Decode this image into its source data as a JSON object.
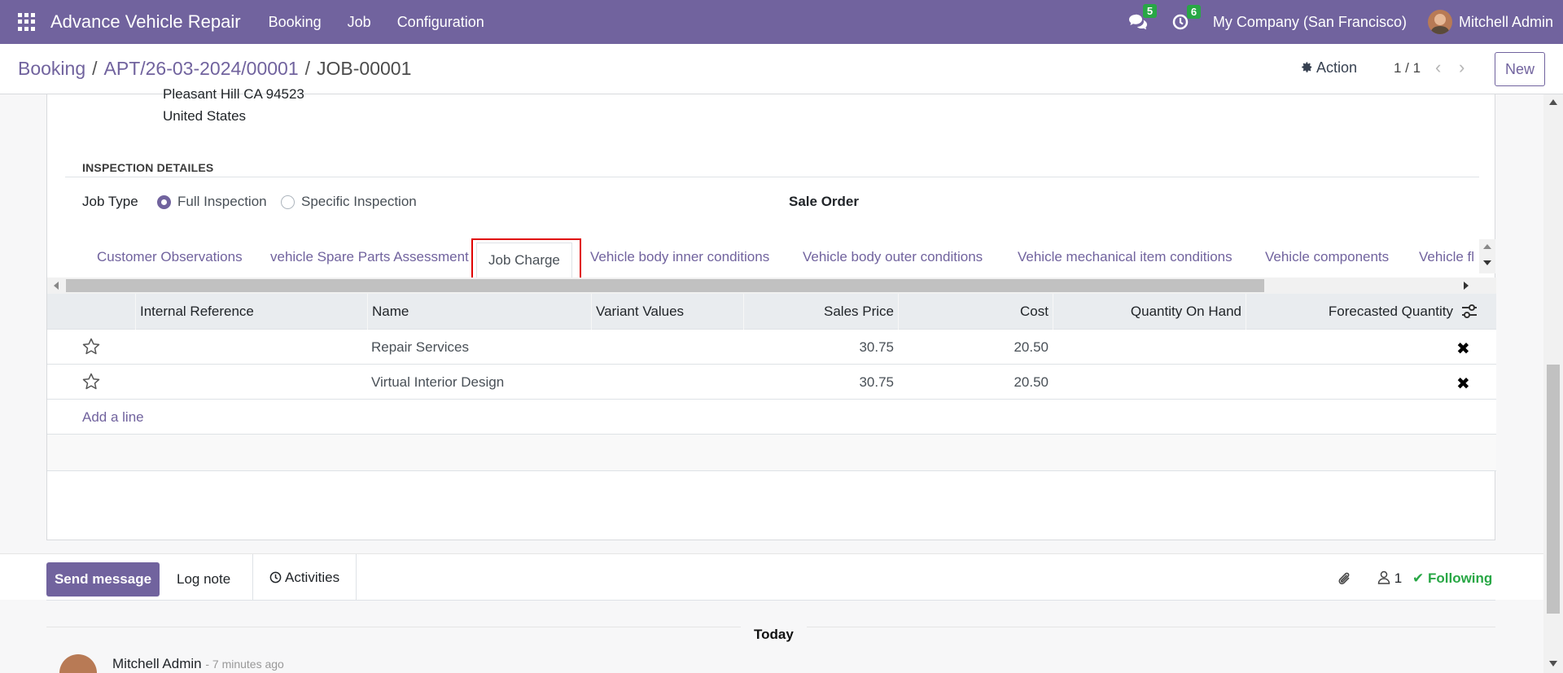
{
  "navbar": {
    "brand": "Advance Vehicle Repair",
    "menu": [
      "Booking",
      "Job",
      "Configuration"
    ],
    "messages_count": "5",
    "activities_count": "6",
    "company": "My Company (San Francisco)",
    "user": "Mitchell Admin"
  },
  "control_panel": {
    "breadcrumb": [
      "Booking",
      "APT/26-03-2024/00001",
      "JOB-00001"
    ],
    "action_label": "Action",
    "pager": "1 / 1",
    "new_label": "New"
  },
  "address": {
    "line1": "Pleasant Hill CA 94523",
    "line2": "United States"
  },
  "inspection": {
    "section_title": "INSPECTION DETAILES",
    "job_type_label": "Job Type",
    "options": [
      "Full Inspection",
      "Specific Inspection"
    ],
    "selected": "Full Inspection",
    "sale_order_label": "Sale Order"
  },
  "tabs": [
    "Customer Observations",
    "vehicle Spare Parts Assessment",
    "Job Charge",
    "Vehicle body inner conditions",
    "Vehicle body outer conditions",
    "Vehicle mechanical item conditions",
    "Vehicle components",
    "Vehicle fl"
  ],
  "active_tab": "Job Charge",
  "table": {
    "headers": [
      "Internal Reference",
      "Name",
      "Variant Values",
      "Sales Price",
      "Cost",
      "Quantity On Hand",
      "Forecasted Quantity"
    ],
    "rows": [
      {
        "internal_reference": "",
        "name": "Repair Services",
        "variant_values": "",
        "sales_price": "30.75",
        "cost": "20.50",
        "qty_on_hand": "",
        "forecasted": ""
      },
      {
        "internal_reference": "",
        "name": "Virtual Interior Design",
        "variant_values": "",
        "sales_price": "30.75",
        "cost": "20.50",
        "qty_on_hand": "",
        "forecasted": ""
      }
    ],
    "add_line": "Add a line"
  },
  "chatter": {
    "send_message": "Send message",
    "log_note": "Log note",
    "activities": "Activities",
    "followers_count": "1",
    "following": "Following",
    "date_separator": "Today",
    "message_author": "Mitchell Admin",
    "message_time": "- 7 minutes ago"
  },
  "colors": {
    "brand": "#71639e",
    "following": "#28a745",
    "badge": "#28a745",
    "highlight": "#e00000"
  }
}
